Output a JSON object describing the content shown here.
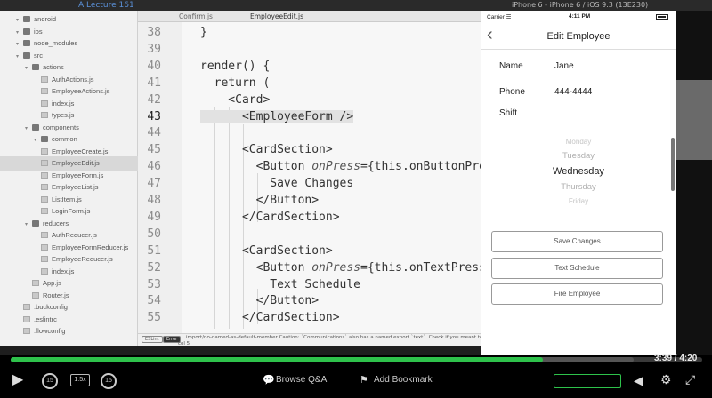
{
  "topbar": {
    "lecture": "A Lecture 161",
    "device": "iPhone 6 - iPhone 6 / iOS 9.3 (13E230)"
  },
  "sidebar": {
    "items": [
      {
        "label": "android",
        "type": "folder",
        "indent": 1
      },
      {
        "label": "ios",
        "type": "folder",
        "indent": 1
      },
      {
        "label": "node_modules",
        "type": "folder",
        "indent": 1
      },
      {
        "label": "src",
        "type": "folder",
        "indent": 1
      },
      {
        "label": "actions",
        "type": "folder",
        "indent": 2
      },
      {
        "label": "AuthActions.js",
        "type": "file",
        "indent": 3
      },
      {
        "label": "EmployeeActions.js",
        "type": "file",
        "indent": 3
      },
      {
        "label": "index.js",
        "type": "file",
        "indent": 3
      },
      {
        "label": "types.js",
        "type": "file",
        "indent": 3
      },
      {
        "label": "components",
        "type": "folder",
        "indent": 2
      },
      {
        "label": "common",
        "type": "folder",
        "indent": 3
      },
      {
        "label": "EmployeeCreate.js",
        "type": "file",
        "indent": 3
      },
      {
        "label": "EmployeeEdit.js",
        "type": "file",
        "indent": 3,
        "selected": true
      },
      {
        "label": "EmployeeForm.js",
        "type": "file",
        "indent": 3
      },
      {
        "label": "EmployeeList.js",
        "type": "file",
        "indent": 3
      },
      {
        "label": "ListItem.js",
        "type": "file",
        "indent": 3
      },
      {
        "label": "LoginForm.js",
        "type": "file",
        "indent": 3
      },
      {
        "label": "reducers",
        "type": "folder",
        "indent": 2
      },
      {
        "label": "AuthReducer.js",
        "type": "file",
        "indent": 3
      },
      {
        "label": "EmployeeFormReducer.js",
        "type": "file",
        "indent": 3
      },
      {
        "label": "EmployeeReducer.js",
        "type": "file",
        "indent": 3
      },
      {
        "label": "index.js",
        "type": "file",
        "indent": 3
      },
      {
        "label": "App.js",
        "type": "file",
        "indent": 2
      },
      {
        "label": "Router.js",
        "type": "file",
        "indent": 2
      },
      {
        "label": ".buckconfig",
        "type": "file",
        "indent": 1
      },
      {
        "label": ".eslintrc",
        "type": "file",
        "indent": 1
      },
      {
        "label": ".flowconfig",
        "type": "file",
        "indent": 1
      }
    ]
  },
  "tabs": [
    "Confirm.js",
    "EmployeeEdit.js"
  ],
  "editor": {
    "lines": [
      {
        "num": "38",
        "text": "}"
      },
      {
        "num": "39",
        "text": ""
      },
      {
        "num": "40",
        "text": "render() {"
      },
      {
        "num": "41",
        "text": "  return ("
      },
      {
        "num": "42",
        "text": "    <Card>"
      },
      {
        "num": "43",
        "text": "      <EmployeeForm />",
        "current": true
      },
      {
        "num": "44",
        "text": ""
      },
      {
        "num": "45",
        "text": "      <CardSection>"
      },
      {
        "num": "46",
        "pre": "        <Button ",
        "attr": "onPress",
        "post": "={this.onButtonPres"
      },
      {
        "num": "47",
        "text": "          Save Changes"
      },
      {
        "num": "48",
        "text": "        </Button>"
      },
      {
        "num": "49",
        "text": "      </CardSection>"
      },
      {
        "num": "50",
        "text": ""
      },
      {
        "num": "51",
        "text": "      <CardSection>"
      },
      {
        "num": "52",
        "pre": "        <Button ",
        "attr": "onPress",
        "post": "={this.onTextPress"
      },
      {
        "num": "53",
        "text": "          Text Schedule"
      },
      {
        "num": "54",
        "text": "        </Button>"
      },
      {
        "num": "55",
        "text": "      </CardSection>"
      }
    ]
  },
  "status": {
    "lint_badge": "ESLint",
    "error_badge": "Error",
    "message": "import/no-named-as-default-member  Caution: `Communications` also has a named export `text`. Check if you meant to",
    "col": "col 5"
  },
  "sim": {
    "carrier": "Carrier ☰",
    "time": "4:11 PM",
    "nav_title": "Edit Employee",
    "back": "‹",
    "fields": [
      {
        "label": "Name",
        "value": "Jane"
      },
      {
        "label": "Phone",
        "value": "444-4444"
      },
      {
        "label": "Shift",
        "value": ""
      }
    ],
    "picker": [
      "Monday",
      "Tuesday",
      "Wednesday",
      "Thursday",
      "Friday"
    ],
    "buttons": [
      "Save Changes",
      "Text Schedule",
      "Fire Employee"
    ]
  },
  "player": {
    "progress": 0.77,
    "current_time": "3:39",
    "total_time": "4:20",
    "time_display": "3:39 / 4:20",
    "speed": "1.5x",
    "skip_back": "15",
    "skip_fwd": "15",
    "browse_qa": "Browse Q&A",
    "add_bookmark": "Add Bookmark",
    "accent": "#2ec24b"
  }
}
